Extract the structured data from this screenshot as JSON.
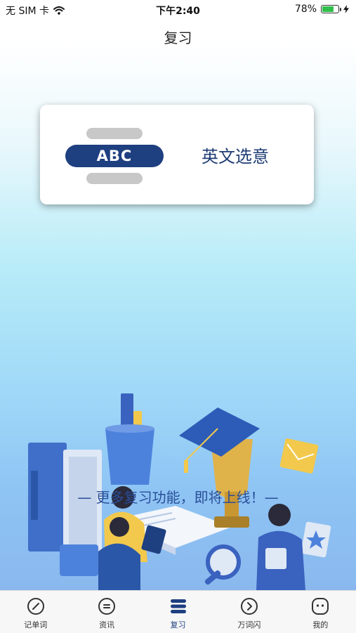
{
  "status_bar": {
    "carrier": "无 SIM 卡",
    "time": "下午2:40",
    "battery": "78%",
    "battery_level": 0.78
  },
  "header": {
    "title": "复习"
  },
  "review_modes": [
    {
      "badge": "ABC",
      "label": "英文选意"
    }
  ],
  "notice": "— 更多复习功能，即将上线！—",
  "tab_bar": {
    "active": 2,
    "tabs": [
      {
        "label": "记单词",
        "icon": "pencil-icon"
      },
      {
        "label": "资讯",
        "icon": "news-icon"
      },
      {
        "label": "复习",
        "icon": "review-icon"
      },
      {
        "label": "万词闪",
        "icon": "flash-icon"
      },
      {
        "label": "我的",
        "icon": "profile-icon"
      }
    ]
  },
  "colors": {
    "accent": "#1e3f80",
    "battery": "#2fbf4a"
  }
}
